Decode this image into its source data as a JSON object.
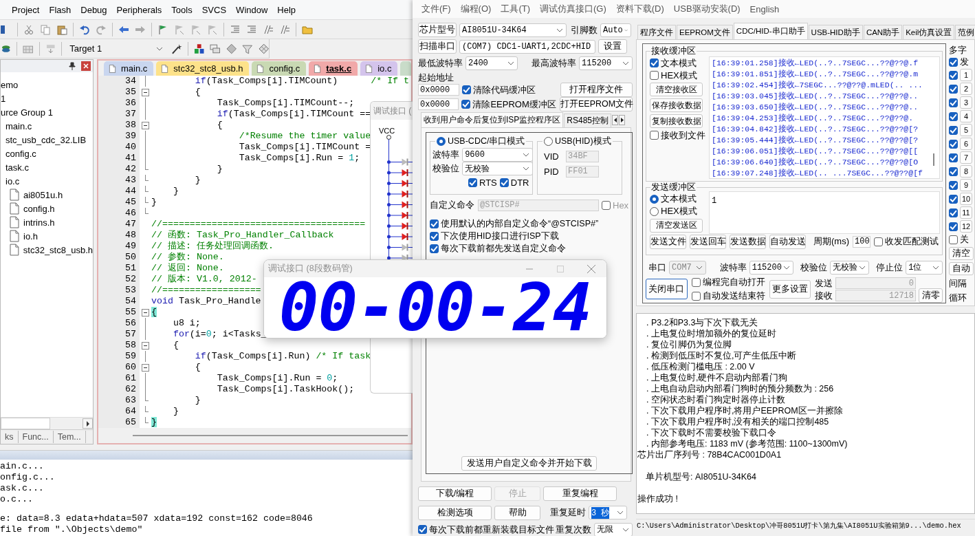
{
  "ide": {
    "menu": [
      "Project",
      "Flash",
      "Debug",
      "Peripherals",
      "Tools",
      "SVCS",
      "Window",
      "Help"
    ],
    "target": "Target 1",
    "project_panel": {
      "tree": [
        {
          "label": "emo",
          "children": [
            {
              "label": "1",
              "children": [
                {
                  "label": "urce Group 1",
                  "children": [
                    {
                      "label": "main.c"
                    },
                    {
                      "label": "stc_usb_cdc_32.LIB"
                    },
                    {
                      "label": "config.c"
                    },
                    {
                      "label": "task.c"
                    },
                    {
                      "label": "io.c",
                      "children": [
                        {
                          "label": "ai8051u.h"
                        },
                        {
                          "label": "config.h"
                        },
                        {
                          "label": "intrins.h"
                        },
                        {
                          "label": "io.h"
                        },
                        {
                          "label": "stc32_stc8_usb.h"
                        }
                      ]
                    }
                  ]
                }
              ]
            }
          ]
        }
      ],
      "tabs": [
        {
          "label": "ks",
          "selected": false
        },
        {
          "label": "Func...",
          "selected": false
        },
        {
          "label": "Tem...",
          "selected": false
        }
      ]
    },
    "editor": {
      "tabs": [
        {
          "label": "main.c",
          "color": "#c9d6ef",
          "selected": false
        },
        {
          "label": "stc32_stc8_usb.h",
          "color": "#fde28a",
          "selected": false
        },
        {
          "label": "config.c",
          "color": "#c9d9b3",
          "selected": false
        },
        {
          "label": "task.c",
          "color": "#f1a9a9",
          "selected": true
        },
        {
          "label": "io.c",
          "color": "#d4c4ec",
          "selected": false
        }
      ],
      "lines": [
        {
          "n": "34",
          "kind": "body",
          "segs": [
            {
              "kind": "kw",
              "text": "        if"
            },
            {
              "kind": "p",
              "text": "(Task_Comps[i].TIMCount)      "
            },
            {
              "kind": "c",
              "text": "/* If t"
            }
          ]
        },
        {
          "n": "35",
          "kind": "fold-start",
          "segs": [
            {
              "kind": "p",
              "text": "        {"
            }
          ]
        },
        {
          "n": "36",
          "kind": "body",
          "segs": [
            {
              "kind": "p",
              "text": "            Task_Comps[i].TIMCount--;"
            }
          ]
        },
        {
          "n": "37",
          "kind": "body",
          "segs": [
            {
              "kind": "kw",
              "text": "            if"
            },
            {
              "kind": "p",
              "text": "(Task_Comps[i].TIMCount =="
            }
          ]
        },
        {
          "n": "38",
          "kind": "fold-start",
          "segs": [
            {
              "kind": "p",
              "text": "            {"
            }
          ]
        },
        {
          "n": "39",
          "kind": "body",
          "segs": [
            {
              "kind": "c",
              "text": "                /*Resume the timer value"
            }
          ]
        },
        {
          "n": "40",
          "kind": "body",
          "segs": [
            {
              "kind": "p",
              "text": "                Task_Comps[i].TIMCount ="
            }
          ]
        },
        {
          "n": "41",
          "kind": "body",
          "segs": [
            {
              "kind": "p",
              "text": "                Task_Comps[i].Run = "
            },
            {
              "kind": "num",
              "text": "1"
            },
            {
              "kind": "p",
              "text": ";"
            }
          ]
        },
        {
          "n": "42",
          "kind": "fold-end",
          "segs": [
            {
              "kind": "p",
              "text": "            }"
            }
          ]
        },
        {
          "n": "43",
          "kind": "fold-end",
          "segs": [
            {
              "kind": "p",
              "text": "        }"
            }
          ]
        },
        {
          "n": "44",
          "kind": "fold-end",
          "segs": [
            {
              "kind": "p",
              "text": "    }"
            }
          ]
        },
        {
          "n": "45",
          "kind": "fold-end",
          "segs": [
            {
              "kind": "p",
              "text": "}"
            }
          ]
        },
        {
          "n": "46",
          "kind": "fold-end"
        },
        {
          "n": "47",
          "kind": "plain",
          "segs": [
            {
              "kind": "c",
              "text": "//====================================="
            }
          ]
        },
        {
          "n": "48",
          "kind": "plain",
          "segs": [
            {
              "kind": "c",
              "text": "// 函数: Task_Pro_Handler_Callback"
            }
          ]
        },
        {
          "n": "49",
          "kind": "plain",
          "segs": [
            {
              "kind": "c",
              "text": "// 描述: 任务处理回调函数."
            }
          ]
        },
        {
          "n": "50",
          "kind": "plain",
          "segs": [
            {
              "kind": "c",
              "text": "// 参数: None."
            }
          ]
        },
        {
          "n": "51",
          "kind": "plain",
          "segs": [
            {
              "kind": "c",
              "text": "// 返回: None."
            }
          ]
        },
        {
          "n": "52",
          "kind": "plain",
          "segs": [
            {
              "kind": "c",
              "text": "// 版本: V1.0, 2012-"
            }
          ]
        },
        {
          "n": "53",
          "kind": "plain",
          "segs": [
            {
              "kind": "c",
              "text": "//=================="
            }
          ]
        },
        {
          "n": "54",
          "kind": "plain",
          "segs": [
            {
              "kind": "kw",
              "text": "void"
            },
            {
              "kind": "p",
              "text": " Task_Pro_Handle"
            }
          ]
        },
        {
          "n": "55",
          "kind": "fold-start",
          "segs": [
            {
              "kind": "match",
              "text": "{"
            }
          ]
        },
        {
          "n": "56",
          "kind": "body",
          "segs": [
            {
              "kind": "p",
              "text": "    u8 i;"
            }
          ]
        },
        {
          "n": "57",
          "kind": "body",
          "segs": [
            {
              "kind": "kw",
              "text": "    for"
            },
            {
              "kind": "p",
              "text": "(i="
            },
            {
              "kind": "num",
              "text": "0"
            },
            {
              "kind": "p",
              "text": "; i<Tasks_"
            }
          ]
        },
        {
          "n": "58",
          "kind": "fold-start",
          "segs": [
            {
              "kind": "p",
              "text": "    {"
            }
          ]
        },
        {
          "n": "59",
          "kind": "body",
          "segs": [
            {
              "kind": "kw",
              "text": "        if"
            },
            {
              "kind": "p",
              "text": "(Task_Comps[i].Run) "
            },
            {
              "kind": "c",
              "text": "/* If task"
            }
          ]
        },
        {
          "n": "60",
          "kind": "fold-start",
          "segs": [
            {
              "kind": "p",
              "text": "        {"
            }
          ]
        },
        {
          "n": "61",
          "kind": "body",
          "segs": [
            {
              "kind": "p",
              "text": "            Task_Comps[i].Run = "
            },
            {
              "kind": "num",
              "text": "0"
            },
            {
              "kind": "p",
              "text": ";"
            }
          ]
        },
        {
          "n": "62",
          "kind": "body",
          "segs": [
            {
              "kind": "p",
              "text": "            Task_Comps[i].TaskHook();"
            }
          ]
        },
        {
          "n": "63",
          "kind": "fold-end",
          "segs": [
            {
              "kind": "p",
              "text": "        }"
            }
          ]
        },
        {
          "n": "64",
          "kind": "fold-end",
          "segs": [
            {
              "kind": "p",
              "text": "    }"
            }
          ]
        },
        {
          "n": "65",
          "kind": "fold-end",
          "segs": [
            {
              "kind": "match",
              "text": "}"
            }
          ]
        }
      ]
    },
    "build_output": [
      "ain.c...",
      "onfig.c...",
      "ask.c...",
      "o.c...",
      "e: data=8.3 edata+hdata=507 xdata=192 const=162 code=8046",
      "file from \".\\Objects\\demo\""
    ]
  },
  "debug_window": {
    "title": "调试接口 (",
    "vcc": "VCC"
  },
  "isp": {
    "menu": [
      "文件(F)",
      "编程(O)",
      "工具(T)",
      "调试仿真接口(G)",
      "资料下载(D)",
      "USB驱动安装(D)",
      "English"
    ],
    "left": {
      "chip_button": "芯片型号",
      "chip": "AI8051U-34K64",
      "pins_label": "引脚数",
      "pins": "Auto",
      "scan_button": "扫描串口",
      "port": "(COM7) CDC1-UART1,2CDC+HID",
      "settings_button": "设置",
      "min_baud_label": "最低波特率",
      "min_baud": "2400",
      "max_baud_label": "最高波特率",
      "max_baud": "115200",
      "start_address_label": "起始地址",
      "address_rows": [
        {
          "address": "0x0000",
          "option": "清除代码缓冲区",
          "checked": true,
          "button": "打开程序文件"
        },
        {
          "address": "0x0000",
          "option": "清除EEPROM缓冲区",
          "checked": true,
          "button": "打开EEPROM文件"
        }
      ],
      "tabs": [
        {
          "label": "收到用户命令后复位到ISP监控程序区",
          "selected": true
        },
        {
          "label": "RS485控制",
          "selected": false
        }
      ],
      "cdc_mode": {
        "label": "USB-CDC/串口模式",
        "selected": true,
        "baud_label": "波特率",
        "baud": "9600",
        "parity_label": "校验位",
        "parity": "无校验",
        "flags": [
          {
            "label": "RTS",
            "checked": true
          },
          {
            "label": "DTR",
            "checked": true
          }
        ]
      },
      "hid_mode": {
        "label": "USB(HID)模式",
        "selected": false,
        "fields": [
          {
            "label": "VID",
            "value": "34BF"
          },
          {
            "label": "PID",
            "value": "FF01"
          }
        ]
      },
      "custom_command": {
        "label": "自定义命令",
        "value": "@STCISP#",
        "hex_label": "Hex",
        "hex_checked": false
      },
      "options": [
        {
          "label": "使用默认的内部自定义命令“@STCISP#”",
          "checked": true
        },
        {
          "label": "下次使用HID接口进行ISP下载",
          "checked": true
        },
        {
          "label": "每次下载前都先发送自定义命令",
          "checked": true
        }
      ],
      "send_command_button": "发送用户自定义命令并开始下载",
      "actions": [
        {
          "label": "下载/编程",
          "disabled": false
        },
        {
          "label": "停止",
          "disabled": true
        },
        {
          "label": "重复编程",
          "disabled": false
        },
        {
          "label": "检测选项",
          "disabled": false
        },
        {
          "label": "帮助",
          "disabled": false
        }
      ],
      "repeat_delay_label": "重复延时",
      "repeat_delay": "3 秒",
      "repeat_delay_highlighted": true,
      "repeat_count_label": "重复次数",
      "repeat_count": "无限",
      "reload_option": {
        "label": "每次下载前都重新装载目标文件",
        "checked": true
      }
    },
    "right": {
      "tabs": [
        {
          "label": "程序文件",
          "selected": false
        },
        {
          "label": "EEPROM文件",
          "selected": false
        },
        {
          "label": "CDC/HID-串口助手",
          "selected": true
        },
        {
          "label": "USB-HID助手",
          "selected": false
        },
        {
          "label": "CAN助手",
          "selected": false
        },
        {
          "label": "Keil仿真设置",
          "selected": false
        },
        {
          "label": "范例",
          "selected": false
        }
      ],
      "receive": {
        "title": "接收缓冲区",
        "modes": [
          {
            "label": "文本模式",
            "checked": true
          },
          {
            "label": "HEX模式",
            "checked": false
          }
        ],
        "buttons": [
          "清空接收区",
          "保存接收数据",
          "复制接收数据"
        ],
        "to_file": {
          "label": "接收到文件",
          "checked": false
        },
        "lines": [
          "[16:39:01.258]接收←LED(..?..7SEGC...??@??@.f",
          "[16:39:01.851]接收←LED(..?..7SEGC...??@??@.m",
          "[16:39:02.454]接收←7SEGC...??@??@.mLED(.. ...",
          "[16:39:03.045]接收←LED(..?..7SEGC...??@??@..",
          "[16:39:03.650]接收←LED(..?..7SEGC...??@??@..",
          "[16:39:04.253]接收←LED(..?..7SEGC...??@??@.",
          "[16:39:04.842]接收←LED(..?..7SEGC...??@??@[?",
          "[16:39:05.444]接收←LED(..?..7SEGC...??@??@[?",
          "[16:39:06.051]接收←LED(..?..7SEGC...??@??@[[",
          "[16:39:06.640]接收←LED(..?..7SEGC...??@??@[O",
          "[16:39:07.248]接收←LED(.. ...7SEGC...??@??@[f"
        ]
      },
      "send": {
        "title": "发送缓冲区",
        "modes": [
          {
            "label": "文本模式",
            "selected": true
          },
          {
            "label": "HEX模式",
            "selected": false
          }
        ],
        "clear_button": "清空发送区",
        "value": "1",
        "buttons": [
          "发送文件",
          "发送回车",
          "发送数据",
          "自动发送"
        ],
        "period_label": "周期(ms)",
        "period": "100",
        "match_test": {
          "label": "收发匹配测试",
          "checked": false
        }
      },
      "port": {
        "port_label": "串口",
        "port": "COM7",
        "baud_label": "波特率",
        "baud": "115200",
        "parity_label": "校验位",
        "parity": "无校验",
        "stop_label": "停止位",
        "stop": "1位"
      },
      "close_port_button": "关闭串口",
      "auto_options": [
        {
          "label": "编程完自动打开",
          "checked": false
        },
        {
          "label": "自动发送结束符",
          "checked": false
        }
      ],
      "more_button": "更多设置",
      "sent_label": "发送",
      "sent": "0",
      "received_label": "接收",
      "received": "12718",
      "clear_button": "清零",
      "multi": {
        "title": "多字",
        "send_all": {
          "label": "发",
          "checked": true
        },
        "items": [
          {
            "label": "1",
            "checked": true
          },
          {
            "label": "2",
            "checked": true
          },
          {
            "label": "3",
            "checked": true
          },
          {
            "label": "4",
            "checked": true
          },
          {
            "label": "5",
            "checked": true
          },
          {
            "label": "6",
            "checked": true
          },
          {
            "label": "7",
            "checked": true
          },
          {
            "label": "8",
            "checked": true
          },
          {
            "label": "9",
            "checked": true
          },
          {
            "label": "10",
            "checked": true
          },
          {
            "label": "11",
            "checked": true
          },
          {
            "label": "12",
            "checked": true
          }
        ],
        "close_hint": {
          "label": "关",
          "checked": false
        },
        "buttons": [
          "清空",
          "自动"
        ],
        "notes": [
          "间隔",
          "循环"
        ]
      }
    },
    "log": [
      {
        "text": ". P3.2和P3.3与下次下载无关",
        "kind": "bullet"
      },
      {
        "text": ". 上电复位时增加额外的复位延时",
        "kind": "bullet"
      },
      {
        "text": ". 复位引脚仍为复位脚",
        "kind": "bullet"
      },
      {
        "text": ". 检测到低压时不复位,可产生低压中断",
        "kind": "bullet"
      },
      {
        "text": ". 低压检测门槛电压 : 2.00 V",
        "kind": "bullet"
      },
      {
        "text": ". 上电复位时,硬件不启动内部看门狗",
        "kind": "bullet"
      },
      {
        "text": ". 上电自动启动内部看门狗时的预分频数为 : 256",
        "kind": "bullet"
      },
      {
        "text": ". 空闲状态时看门狗定时器停止计数",
        "kind": "bullet"
      },
      {
        "text": ". 下次下载用户程序时,将用户EEPROM区一并擦除",
        "kind": "bullet"
      },
      {
        "text": ". 下次下载用户程序时,没有相关的端口控制485",
        "kind": "bullet"
      },
      {
        "text": ". 下次下载时不需要校验下载口令",
        "kind": "bullet"
      },
      {
        "text": ". 内部参考电压: 1183 mV (参考范围: 1100~1300mV)",
        "kind": "bullet"
      },
      {
        "text": "芯片出厂序列号 : 78B4CAC001D0A1",
        "kind": "plain"
      },
      {
        "kind": "blank"
      },
      {
        "text": "单片机型号: AI8051U-34K64",
        "kind": "indented"
      },
      {
        "kind": "blank"
      },
      {
        "text": "操作成功 !",
        "kind": "plain"
      }
    ],
    "path": "C:\\Users\\Administrator\\Desktop\\冲哥8051U打卡\\第九集\\AI8051U实验箱第9...\\demo.hex"
  },
  "segment_window": {
    "title": "调试接口 (8段数码管)",
    "display": "00-00-24"
  }
}
